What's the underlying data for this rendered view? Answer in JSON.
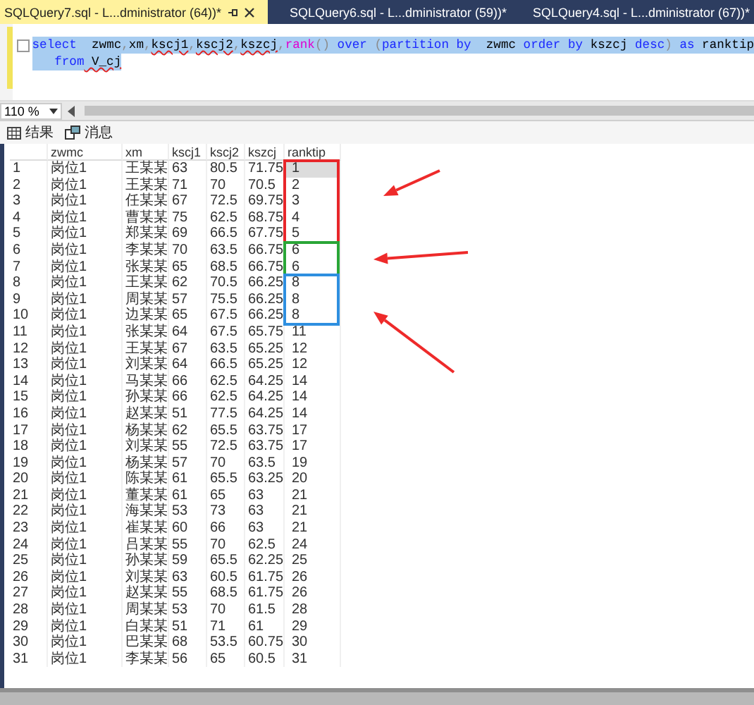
{
  "tabs": [
    {
      "label": "SQLQuery7.sql - L...dministrator (64))*",
      "selected": true
    },
    {
      "label": "SQLQuery6.sql - L...dministrator (59))*",
      "selected": false
    },
    {
      "label": "SQLQuery4.sql - L...dministrator (67))*",
      "selected": false
    }
  ],
  "editor": {
    "lines": [
      [
        {
          "kind": "keyword",
          "text": "select"
        },
        {
          "kind": "ident",
          "text": "  zwmc"
        },
        {
          "kind": "punct",
          "text": ","
        },
        {
          "kind": "ident",
          "text": "xm"
        },
        {
          "kind": "punct",
          "text": ","
        },
        {
          "kind": "error",
          "text": "kscj1"
        },
        {
          "kind": "punct",
          "text": ","
        },
        {
          "kind": "error",
          "text": "kscj2"
        },
        {
          "kind": "punct",
          "text": ","
        },
        {
          "kind": "error",
          "text": "kszcj"
        },
        {
          "kind": "punct",
          "text": ","
        },
        {
          "kind": "func",
          "text": "rank"
        },
        {
          "kind": "punct",
          "text": "()"
        },
        {
          "kind": "keyword",
          "text": " over"
        },
        {
          "kind": "punct",
          "text": " ("
        },
        {
          "kind": "keyword",
          "text": "partition by"
        },
        {
          "kind": "ident",
          "text": "  zwmc"
        },
        {
          "kind": "keyword",
          "text": " order by"
        },
        {
          "kind": "ident",
          "text": " kszcj"
        },
        {
          "kind": "keyword",
          "text": " desc"
        },
        {
          "kind": "punct",
          "text": ")"
        },
        {
          "kind": "keyword",
          "text": " as"
        },
        {
          "kind": "ident",
          "text": " ranktip"
        }
      ],
      [
        {
          "kind": "keyword",
          "text": "   from"
        },
        {
          "kind": "error",
          "text": " V_cj"
        }
      ]
    ]
  },
  "zoom": "110 %",
  "result_tabs": [
    {
      "label": "结果",
      "kind": "grid"
    },
    {
      "label": "消息",
      "kind": "messages"
    }
  ],
  "table": {
    "columns": [
      "zwmc",
      "xm",
      "kscj1",
      "kscj2",
      "kszcj",
      "ranktip"
    ],
    "rows": [
      {
        "number": "1",
        "cells": [
          "岗位1",
          "王某某",
          "63",
          "80.5",
          "71.75",
          "1"
        ],
        "selected": true,
        "color": "#e8262a"
      },
      {
        "number": "2",
        "cells": [
          "岗位1",
          "王某某",
          "71",
          "70",
          "70.5",
          "2"
        ],
        "selected": false,
        "color": "#e8262a"
      },
      {
        "number": "3",
        "cells": [
          "岗位1",
          "任某某",
          "67",
          "72.5",
          "69.75",
          "3"
        ],
        "selected": false,
        "color": "#e8262a"
      },
      {
        "number": "4",
        "cells": [
          "岗位1",
          "曹某某",
          "75",
          "62.5",
          "68.75",
          "4"
        ],
        "selected": false,
        "color": "#e8262a"
      },
      {
        "number": "5",
        "cells": [
          "岗位1",
          "郑某某",
          "69",
          "66.5",
          "67.75",
          "5"
        ],
        "selected": false,
        "color": "#e8262a"
      },
      {
        "number": "6",
        "cells": [
          "岗位1",
          "李某某",
          "70",
          "63.5",
          "66.75",
          "6"
        ],
        "selected": false,
        "color": "#2aa637"
      },
      {
        "number": "7",
        "cells": [
          "岗位1",
          "张某某",
          "65",
          "68.5",
          "66.75",
          "6"
        ],
        "selected": false,
        "color": "#2aa637"
      },
      {
        "number": "8",
        "cells": [
          "岗位1",
          "王某某",
          "62",
          "70.5",
          "66.25",
          "8"
        ],
        "selected": false,
        "color": "#2e8fe0"
      },
      {
        "number": "9",
        "cells": [
          "岗位1",
          "周某某",
          "57",
          "75.5",
          "66.25",
          "8"
        ],
        "selected": false,
        "color": "#2e8fe0"
      },
      {
        "number": "10",
        "cells": [
          "岗位1",
          "边某某",
          "65",
          "67.5",
          "66.25",
          "8"
        ],
        "selected": false,
        "color": "#2e8fe0"
      },
      {
        "number": "11",
        "cells": [
          "岗位1",
          "张某某",
          "64",
          "67.5",
          "65.75",
          "11"
        ],
        "selected": false
      },
      {
        "number": "12",
        "cells": [
          "岗位1",
          "王某某",
          "67",
          "63.5",
          "65.25",
          "12"
        ],
        "selected": false
      },
      {
        "number": "13",
        "cells": [
          "岗位1",
          "刘某某",
          "64",
          "66.5",
          "65.25",
          "12"
        ],
        "selected": false
      },
      {
        "number": "14",
        "cells": [
          "岗位1",
          "马某某",
          "66",
          "62.5",
          "64.25",
          "14"
        ],
        "selected": false
      },
      {
        "number": "15",
        "cells": [
          "岗位1",
          "孙某某",
          "66",
          "62.5",
          "64.25",
          "14"
        ],
        "selected": false
      },
      {
        "number": "16",
        "cells": [
          "岗位1",
          "赵某某",
          "51",
          "77.5",
          "64.25",
          "14"
        ],
        "selected": false
      },
      {
        "number": "17",
        "cells": [
          "岗位1",
          "杨某某",
          "62",
          "65.5",
          "63.75",
          "17"
        ],
        "selected": false
      },
      {
        "number": "18",
        "cells": [
          "岗位1",
          "刘某某",
          "55",
          "72.5",
          "63.75",
          "17"
        ],
        "selected": false
      },
      {
        "number": "19",
        "cells": [
          "岗位1",
          "杨某某",
          "57",
          "70",
          "63.5",
          "19"
        ],
        "selected": false
      },
      {
        "number": "20",
        "cells": [
          "岗位1",
          "陈某某",
          "61",
          "65.5",
          "63.25",
          "20"
        ],
        "selected": false
      },
      {
        "number": "21",
        "cells": [
          "岗位1",
          "董某某",
          "61",
          "65",
          "63",
          "21"
        ],
        "selected": false
      },
      {
        "number": "22",
        "cells": [
          "岗位1",
          "海某某",
          "53",
          "73",
          "63",
          "21"
        ],
        "selected": false
      },
      {
        "number": "23",
        "cells": [
          "岗位1",
          "崔某某",
          "60",
          "66",
          "63",
          "21"
        ],
        "selected": false
      },
      {
        "number": "24",
        "cells": [
          "岗位1",
          "吕某某",
          "55",
          "70",
          "62.5",
          "24"
        ],
        "selected": false
      },
      {
        "number": "25",
        "cells": [
          "岗位1",
          "孙某某",
          "59",
          "65.5",
          "62.25",
          "25"
        ],
        "selected": false
      },
      {
        "number": "26",
        "cells": [
          "岗位1",
          "刘某某",
          "63",
          "60.5",
          "61.75",
          "26"
        ],
        "selected": false
      },
      {
        "number": "27",
        "cells": [
          "岗位1",
          "赵某某",
          "55",
          "68.5",
          "61.75",
          "26"
        ],
        "selected": false
      },
      {
        "number": "28",
        "cells": [
          "岗位1",
          "周某某",
          "53",
          "70",
          "61.5",
          "28"
        ],
        "selected": false
      },
      {
        "number": "29",
        "cells": [
          "岗位1",
          "白某某",
          "51",
          "71",
          "61",
          "29"
        ],
        "selected": false
      },
      {
        "number": "30",
        "cells": [
          "岗位1",
          "巴某某",
          "68",
          "53.5",
          "60.75",
          "30"
        ],
        "selected": false
      },
      {
        "number": "31",
        "cells": [
          "岗位1",
          "李某某",
          "56",
          "65",
          "60.5",
          "31"
        ],
        "selected": false
      }
    ]
  }
}
